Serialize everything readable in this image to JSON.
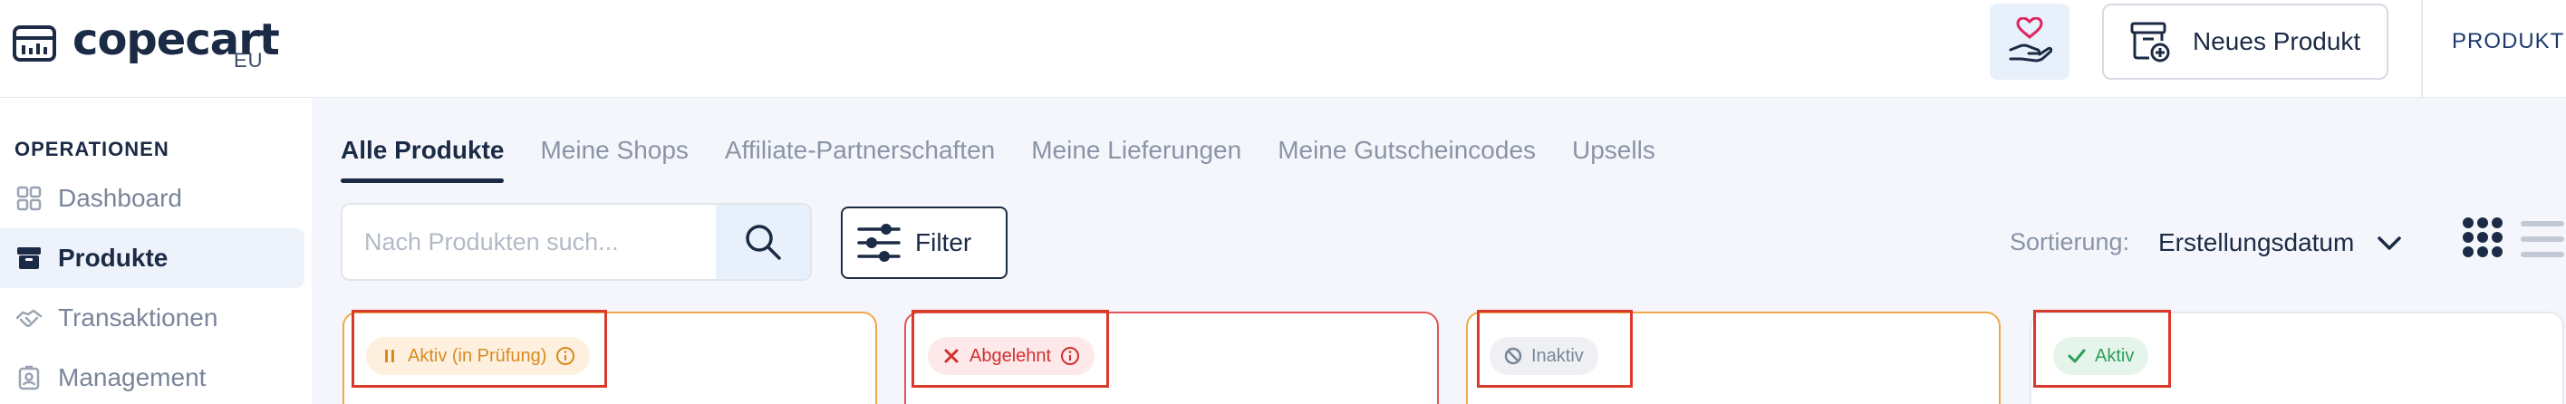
{
  "header": {
    "logo_text": "copecart",
    "logo_sub": "EU",
    "new_product_label": "Neues Produkt",
    "nav_link": "PRODUKTE"
  },
  "sidebar": {
    "heading": "OPERATIONEN",
    "items": [
      {
        "label": "Dashboard",
        "icon": "grid-icon",
        "active": false
      },
      {
        "label": "Produkte",
        "icon": "archive-icon",
        "active": true
      },
      {
        "label": "Transaktionen",
        "icon": "handshake-icon",
        "active": false
      },
      {
        "label": "Management",
        "icon": "user-badge-icon",
        "active": false
      }
    ]
  },
  "tabs": [
    {
      "label": "Alle Produkte",
      "active": true
    },
    {
      "label": "Meine Shops",
      "active": false
    },
    {
      "label": "Affiliate-Partnerschaften",
      "active": false
    },
    {
      "label": "Meine Lieferungen",
      "active": false
    },
    {
      "label": "Meine Gutscheincodes",
      "active": false
    },
    {
      "label": "Upsells",
      "active": false
    }
  ],
  "search": {
    "placeholder": "Nach Produkten such...",
    "value": ""
  },
  "filter": {
    "label": "Filter"
  },
  "sort": {
    "label": "Sortierung:",
    "value": "Erstellungsdatum"
  },
  "cards": [
    {
      "status": "Aktiv (in Prüfung)",
      "kind": "review"
    },
    {
      "status": "Abgelehnt",
      "kind": "rejected"
    },
    {
      "status": "Inaktiv",
      "kind": "inactive"
    },
    {
      "status": "Aktiv",
      "kind": "active"
    }
  ],
  "colors": {
    "primary": "#1c2b45",
    "review": "#d98a1f",
    "rejected": "#d32f2f",
    "inactive": "#7a8599",
    "active": "#2e9e5b",
    "highlight": "#d93a2b"
  }
}
